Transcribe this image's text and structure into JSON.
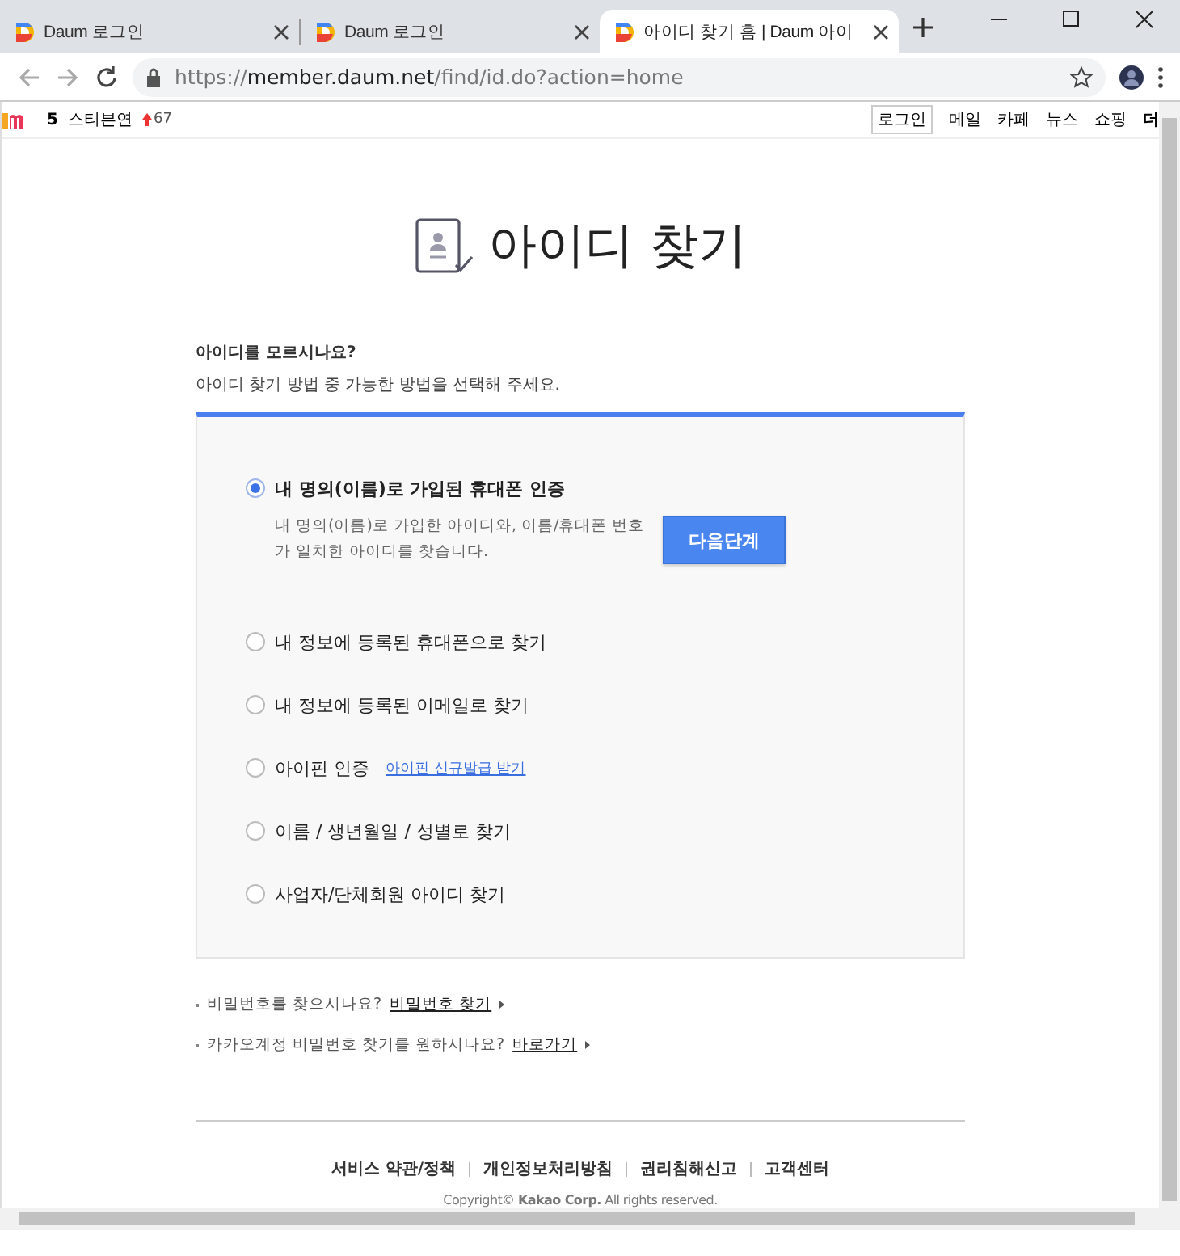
{
  "browser": {
    "tabs": [
      {
        "title": "Daum 로그인",
        "selected": false
      },
      {
        "title": "Daum 로그인",
        "selected": false
      },
      {
        "title": "아이디 찾기 홈 | Daum 아이",
        "selected": true
      }
    ],
    "url": {
      "scheme": "https://",
      "host": "member.daum.net",
      "path": "/find/id.do?action=home"
    }
  },
  "topbar": {
    "rank": "5",
    "keyword": "스티븐연",
    "change": "67",
    "links": [
      {
        "label": "로그인",
        "kind": "boxed"
      },
      {
        "label": "메일",
        "kind": "plain"
      },
      {
        "label": "카페",
        "kind": "plain"
      },
      {
        "label": "뉴스",
        "kind": "plain"
      },
      {
        "label": "쇼핑",
        "kind": "plain"
      },
      {
        "label": "더",
        "kind": "strong"
      }
    ]
  },
  "title": "아이디 찾기",
  "question": "아이디를 모르시나요?",
  "instruction": "아이디 찾기 방법 중 가능한 방법을 선택해 주세요.",
  "options": [
    {
      "label": "내 명의(이름)로 가입된 휴대폰 인증",
      "selected": true,
      "description": "내 명의(이름)로 가입한 아이디와, 이름/휴대폰 번호가 일치한 아이디를 찾습니다.",
      "button": "다음단계"
    },
    {
      "label": "내 정보에 등록된 휴대폰으로 찾기",
      "selected": false
    },
    {
      "label": "내 정보에 등록된 이메일로 찾기",
      "selected": false
    },
    {
      "label": "아이핀 인증",
      "selected": false,
      "link": "아이핀 신규발급 받기"
    },
    {
      "label": "이름 / 생년월일 / 성별로 찾기",
      "selected": false
    },
    {
      "label": "사업자/단체회원 아이디 찾기",
      "selected": false
    }
  ],
  "help": [
    {
      "text": "비밀번호를 찾으시나요?",
      "link": "비밀번호 찾기"
    },
    {
      "text": "카카오계정 비밀번호 찾기를 원하시나요?",
      "link": "바로가기"
    }
  ],
  "footer": {
    "links": [
      "서비스 약관/정책",
      "개인정보처리방침",
      "권리침해신고",
      "고객센터"
    ],
    "copyright": "Copyright© **Kakao Corp.** All rights reserved."
  }
}
